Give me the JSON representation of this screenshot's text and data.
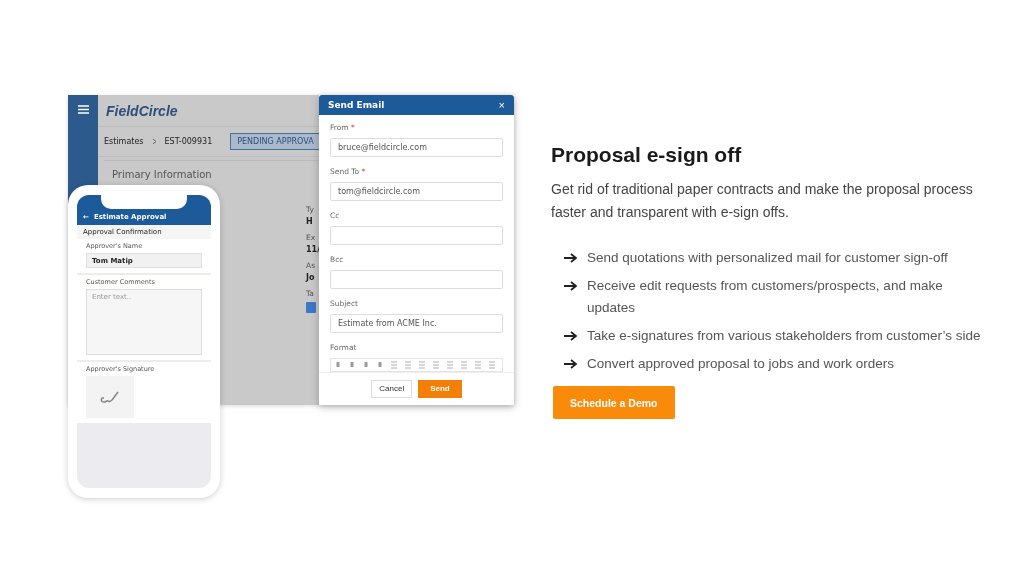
{
  "app": {
    "logo": "FieldCircle",
    "breadcrumb": [
      "Estimates",
      "EST-009931"
    ],
    "status": "PENDING APPROVA",
    "section_title": "Primary Information",
    "fields": [
      {
        "label": "Ty",
        "value": "H"
      },
      {
        "label": "Ex",
        "value": "11/"
      },
      {
        "label": "As",
        "value": "Jo"
      },
      {
        "label": "Ta"
      }
    ]
  },
  "email_dialog": {
    "title": "Send Email",
    "close": "×",
    "fields": [
      {
        "label": "From",
        "marker": "*",
        "value": "bruce@fieldcircle.com"
      },
      {
        "label": "Send To",
        "marker": "*",
        "value": "tom@fieldcircle.com"
      },
      {
        "label": "Cc"
      },
      {
        "label": "Bcc"
      },
      {
        "label": "Subject",
        "value": "Estimate from ACME Inc."
      }
    ],
    "format_label": "Format",
    "cancel": "Cancel",
    "send": "Send"
  },
  "phone": {
    "back": "←",
    "title": "Estimate Approval",
    "section": "Approval Confirmation",
    "name_label": "Approver's Name",
    "name_value": "Tom Matip",
    "comments_label": "Customer Comments",
    "comments_placeholder": "Enter text..",
    "signature_label": "Approver's Signature"
  },
  "feature": {
    "title": "Proposal e-sign off",
    "description": "Get rid of traditional paper contracts and make the proposal process faster and transparent with e-sign offs.",
    "bullets": [
      "Send quotations with personalized mail for customer sign-off",
      "Receive edit requests from customers/prospects, and make updates",
      "Take e-signatures from various stakeholders from customer’s side",
      "Convert approved proposal to jobs and work orders"
    ],
    "cta": "Schedule a Demo"
  }
}
